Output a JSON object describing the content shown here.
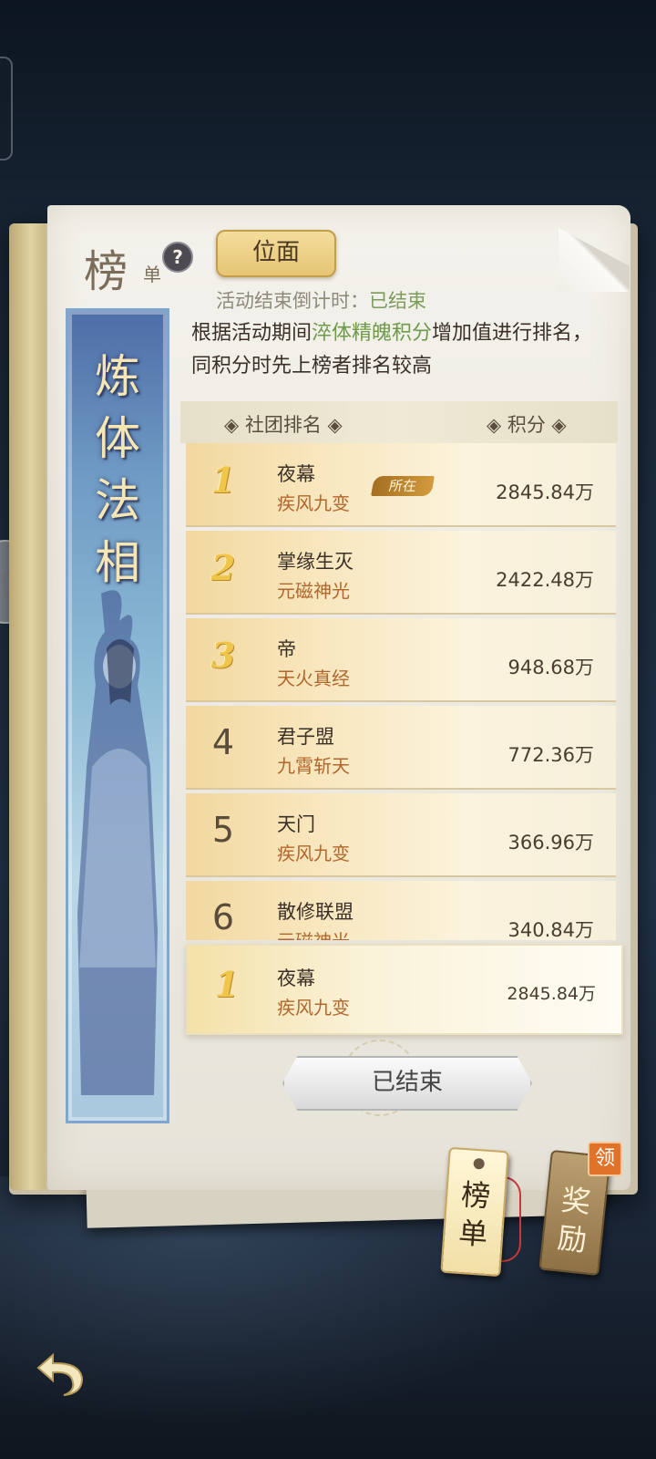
{
  "title": {
    "main": "榜",
    "sub": "单",
    "help": "?"
  },
  "tab": {
    "label": "位面"
  },
  "countdown": {
    "label": "活动结束倒计时：",
    "value": "已结束"
  },
  "description": {
    "pre": "根据活动期间",
    "highlight": "淬体精魄积分",
    "post": "增加值进行排名，同积分时先上榜者排名较高"
  },
  "banner": {
    "chars": [
      "炼",
      "体",
      "法",
      "相"
    ]
  },
  "list_header": {
    "rank_label": "◈ 社团排名 ◈",
    "score_label": "◈ 积分 ◈"
  },
  "rankings": [
    {
      "rank": "1",
      "name": "夜幕",
      "skill": "疾风九变",
      "score": "2845.84",
      "unit": "万",
      "badge": "所在"
    },
    {
      "rank": "2",
      "name": "掌缘生灭",
      "skill": "元磁神光",
      "score": "2422.48",
      "unit": "万"
    },
    {
      "rank": "3",
      "name": "帝",
      "skill": "天火真经",
      "score": "948.68",
      "unit": "万"
    },
    {
      "rank": "4",
      "name": "君子盟",
      "skill": "九霄斩天",
      "score": "772.36",
      "unit": "万"
    },
    {
      "rank": "5",
      "name": "天门",
      "skill": "疾风九变",
      "score": "366.96",
      "unit": "万"
    },
    {
      "rank": "6",
      "name": "散修联盟",
      "skill": "元磁神光",
      "score": "340.84",
      "unit": "万"
    }
  ],
  "my_rank": {
    "rank": "1",
    "name": "夜幕",
    "skill": "疾风九变",
    "score": "2845.84万"
  },
  "status_button": {
    "label": "已结束"
  },
  "tags": {
    "rank": "榜单",
    "reward": "奖励",
    "claim": "领"
  },
  "colors": {
    "highlight": "#6f9a4a",
    "skill": "#b1672c",
    "top_rank_gold": "#f0c64a"
  }
}
